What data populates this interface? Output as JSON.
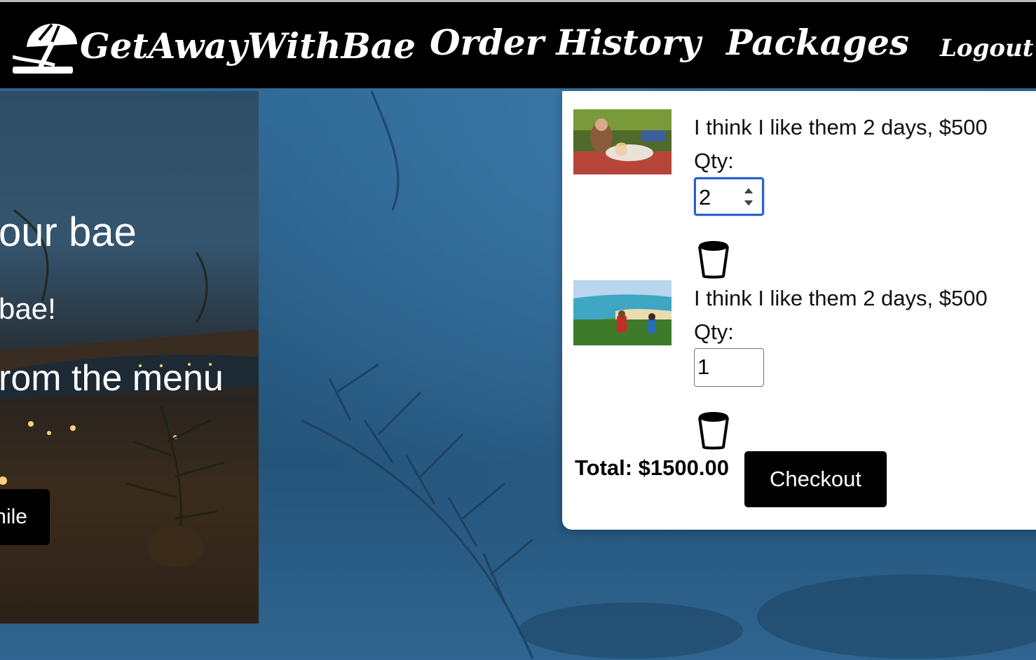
{
  "navbar": {
    "brand": "GetAwayWithBae",
    "logo_icon": "beach-umbrella-icon",
    "links": {
      "order_history": "Order History",
      "packages": "Packages",
      "logout": "Logout"
    }
  },
  "hero": {
    "title": "our bae",
    "subtitle_1": "bae!",
    "subtitle_2": "rom the menu",
    "button_label": "hile"
  },
  "cart": {
    "items": [
      {
        "name": "I think I like them 2 days, $500",
        "qty_label": "Qty:",
        "qty": "2",
        "image": "couple-picnic-photo",
        "delete_icon": "trash-icon"
      },
      {
        "name": "I think I like them 2 days, $500",
        "qty_label": "Qty:",
        "qty": "1",
        "image": "hikers-coast-photo",
        "delete_icon": "trash-icon"
      }
    ],
    "total_label": "Total: $1500.00",
    "checkout_label": "Checkout"
  },
  "colors": {
    "navbar_bg": "#000000",
    "focus_ring": "#2a5fd1",
    "checkout_bg": "#000000",
    "page_bg": "#2d5f88"
  }
}
